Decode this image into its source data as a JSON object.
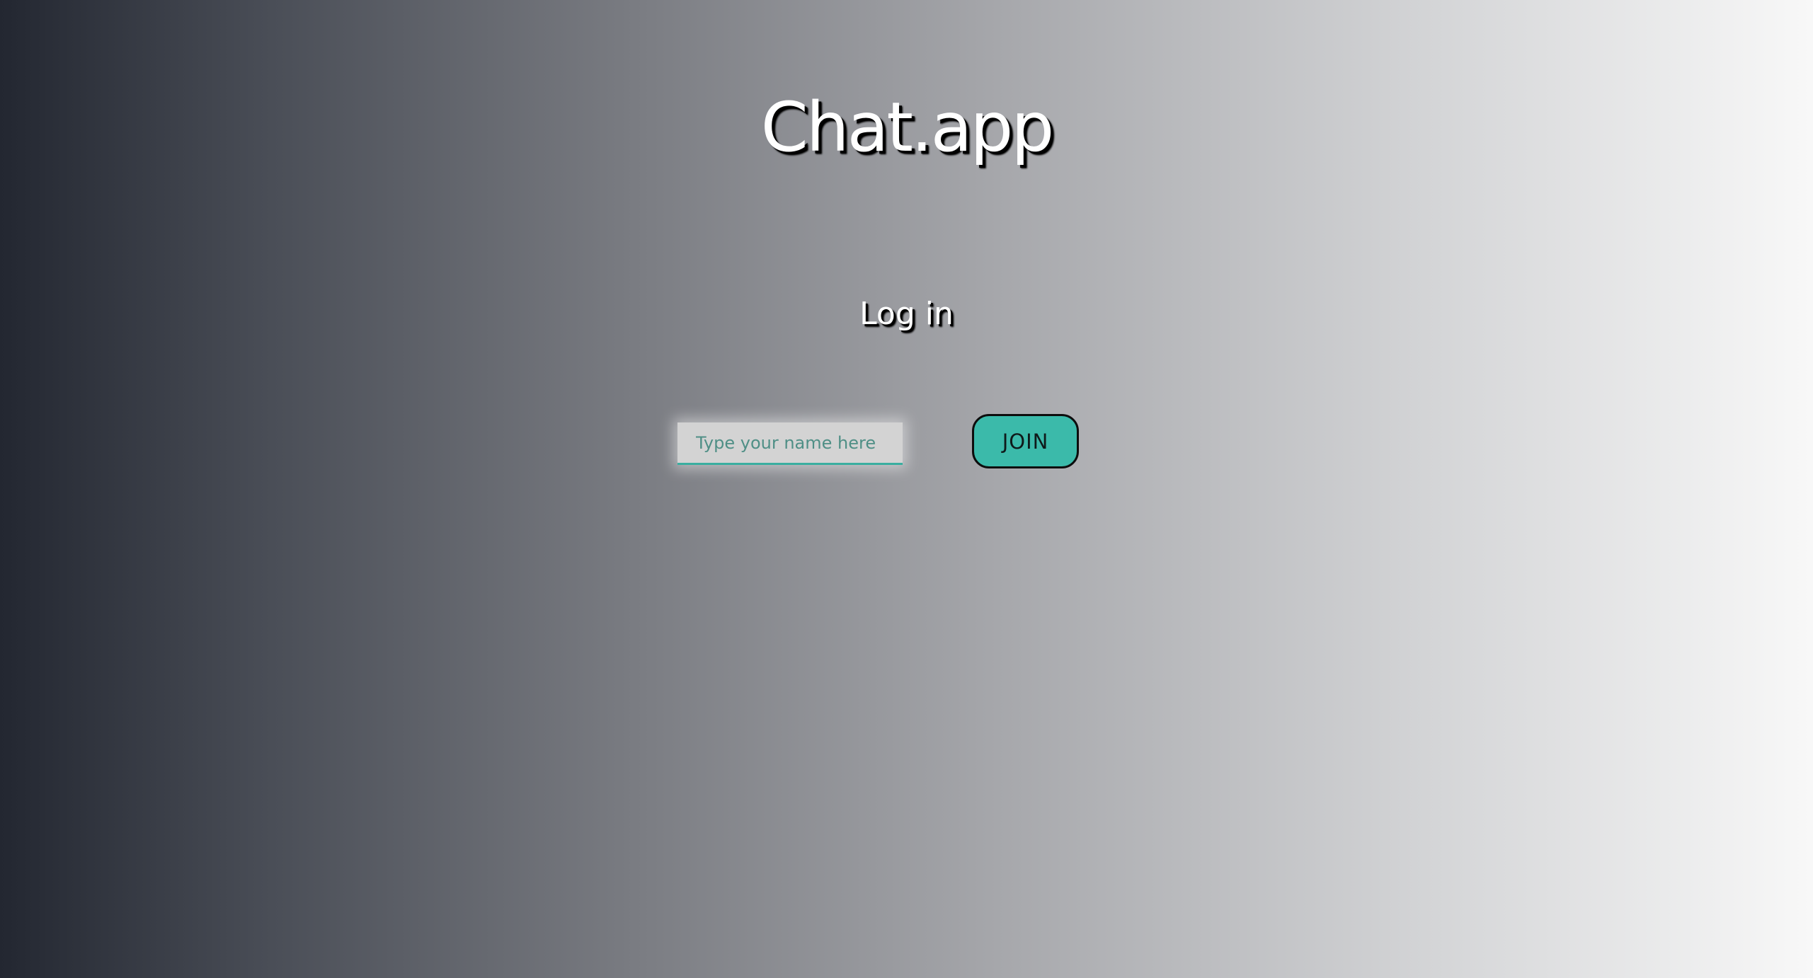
{
  "app": {
    "title": "Chat.app"
  },
  "login": {
    "heading": "Log in",
    "name_input": {
      "placeholder": "Type your name here",
      "value": ""
    },
    "join_label": "JOIN"
  },
  "colors": {
    "accent": "#3bbaaa",
    "input_underline": "#3aaea0",
    "input_background": "#d3d3d3",
    "gradient_start": "#232731",
    "gradient_end": "#f8f8f8"
  }
}
